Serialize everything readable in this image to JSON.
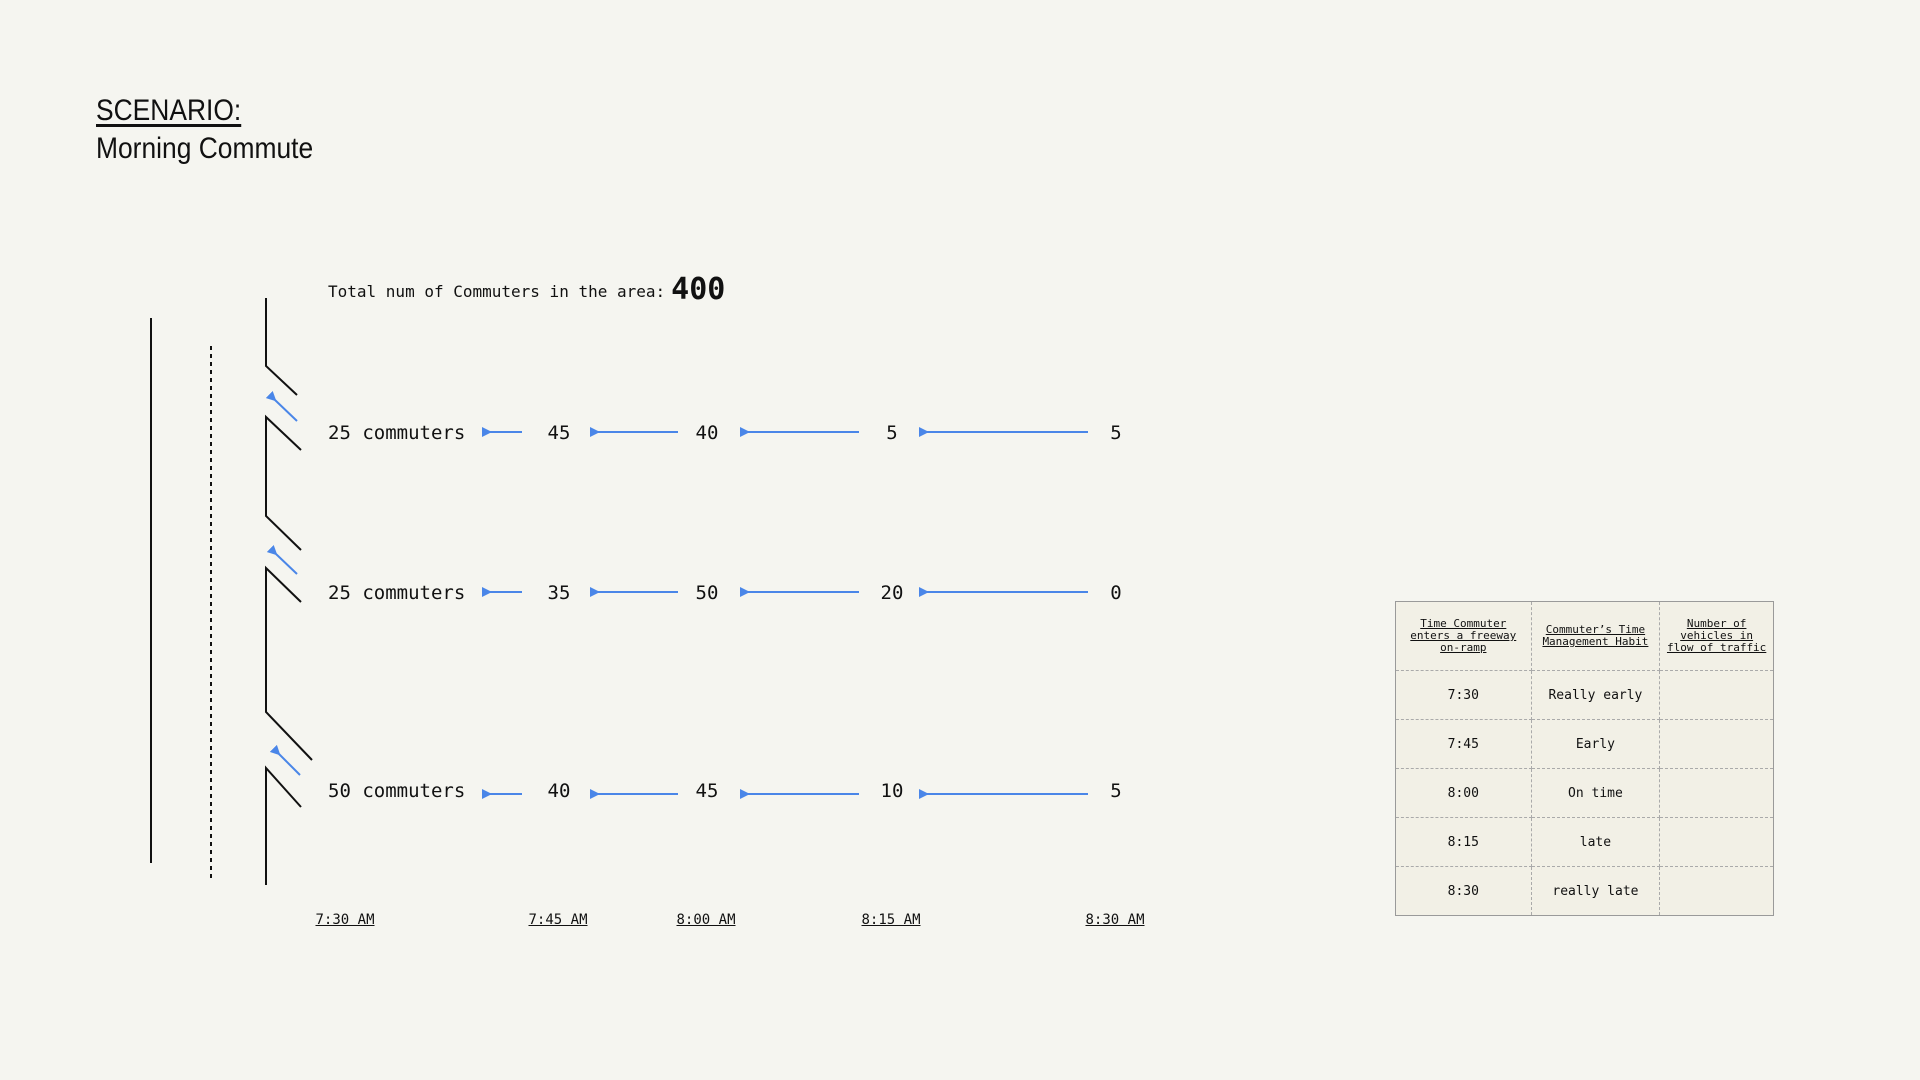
{
  "scenario": {
    "heading": "SCENARIO:",
    "name": "Morning Commute"
  },
  "total": {
    "label": "Total num of Commuters in the area:",
    "value": "400"
  },
  "colors": {
    "arrow": "#4a86e8",
    "road": "#111111"
  },
  "ramps": [
    {
      "label": "25 commuters",
      "values": [
        "45",
        "40",
        "5",
        "5"
      ]
    },
    {
      "label": "25 commuters",
      "values": [
        "35",
        "50",
        "20",
        "0"
      ]
    },
    {
      "label": "50 commuters",
      "values": [
        "40",
        "45",
        "10",
        "5"
      ]
    }
  ],
  "times": [
    "7:30 AM",
    "7:45 AM",
    "8:00 AM",
    "8:15 AM",
    "8:30 AM"
  ],
  "table": {
    "headers": [
      "Time Commuter enters a freeway on-ramp",
      "Commuter’s Time Management Habit",
      "Number of vehicles in flow of traffic"
    ],
    "rows": [
      [
        "7:30",
        "Really early",
        ""
      ],
      [
        "7:45",
        "Early",
        ""
      ],
      [
        "8:00",
        "On time",
        ""
      ],
      [
        "8:15",
        "late",
        ""
      ],
      [
        "8:30",
        "really late",
        ""
      ]
    ]
  }
}
